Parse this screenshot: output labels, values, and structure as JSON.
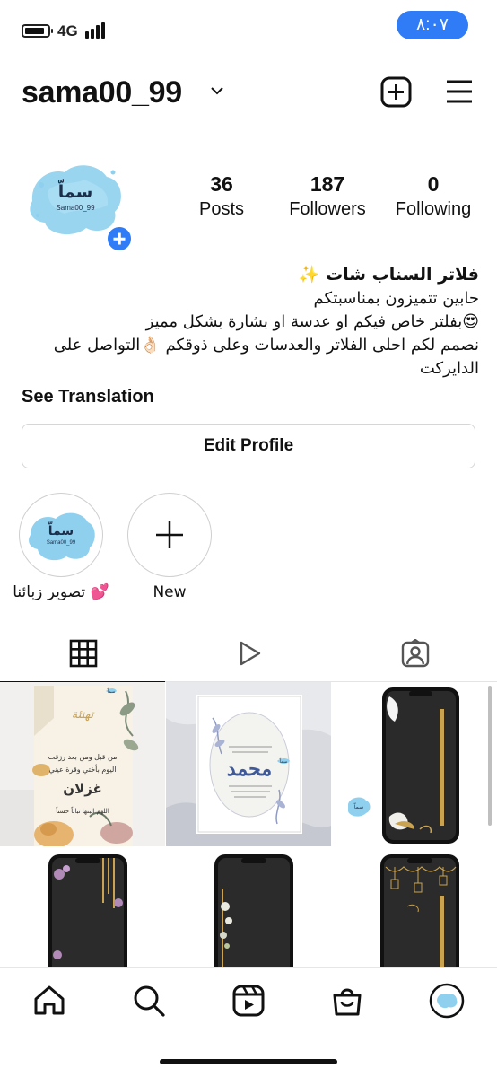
{
  "status_bar": {
    "network": "4G",
    "time": "٨:٠٧"
  },
  "header": {
    "username": "sama00_99"
  },
  "profile": {
    "avatar_text": "سماّ",
    "avatar_subtext": "Sama00_99",
    "stats": [
      {
        "value": "36",
        "label": "Posts"
      },
      {
        "value": "187",
        "label": "Followers"
      },
      {
        "value": "0",
        "label": "Following"
      }
    ],
    "bio_name": "فلاتر السناب شات ✨",
    "bio_lines": [
      "حابين تتميزون بمناسبتكم",
      "😍بفلتر خاص فيكم او عدسة او بشارة بشكل مميز",
      "نصمم لكم احلى الفلاتر والعدسات وعلى ذوقكم 👌🏻التواصل على",
      "الدايركت"
    ],
    "see_translation": "See Translation",
    "edit_profile": "Edit Profile"
  },
  "highlights": [
    {
      "label": "تصوير زبائنا 💕",
      "image_text": "سماّ"
    },
    {
      "label": "New"
    }
  ],
  "posts": {
    "p1_lines": [
      "من قبل ومن بعد رزقت",
      "اليوم بأختي وقرة عيني",
      "غزلان",
      "اللهم انبتها نباتاً حسناً"
    ],
    "p1_title": "تهنئة",
    "p2_name": "محمد",
    "badge": "سماّ"
  },
  "colors": {
    "accent": "#2f7cf6",
    "watercolor": "#8fd0ee",
    "gold": "#c9a352"
  }
}
